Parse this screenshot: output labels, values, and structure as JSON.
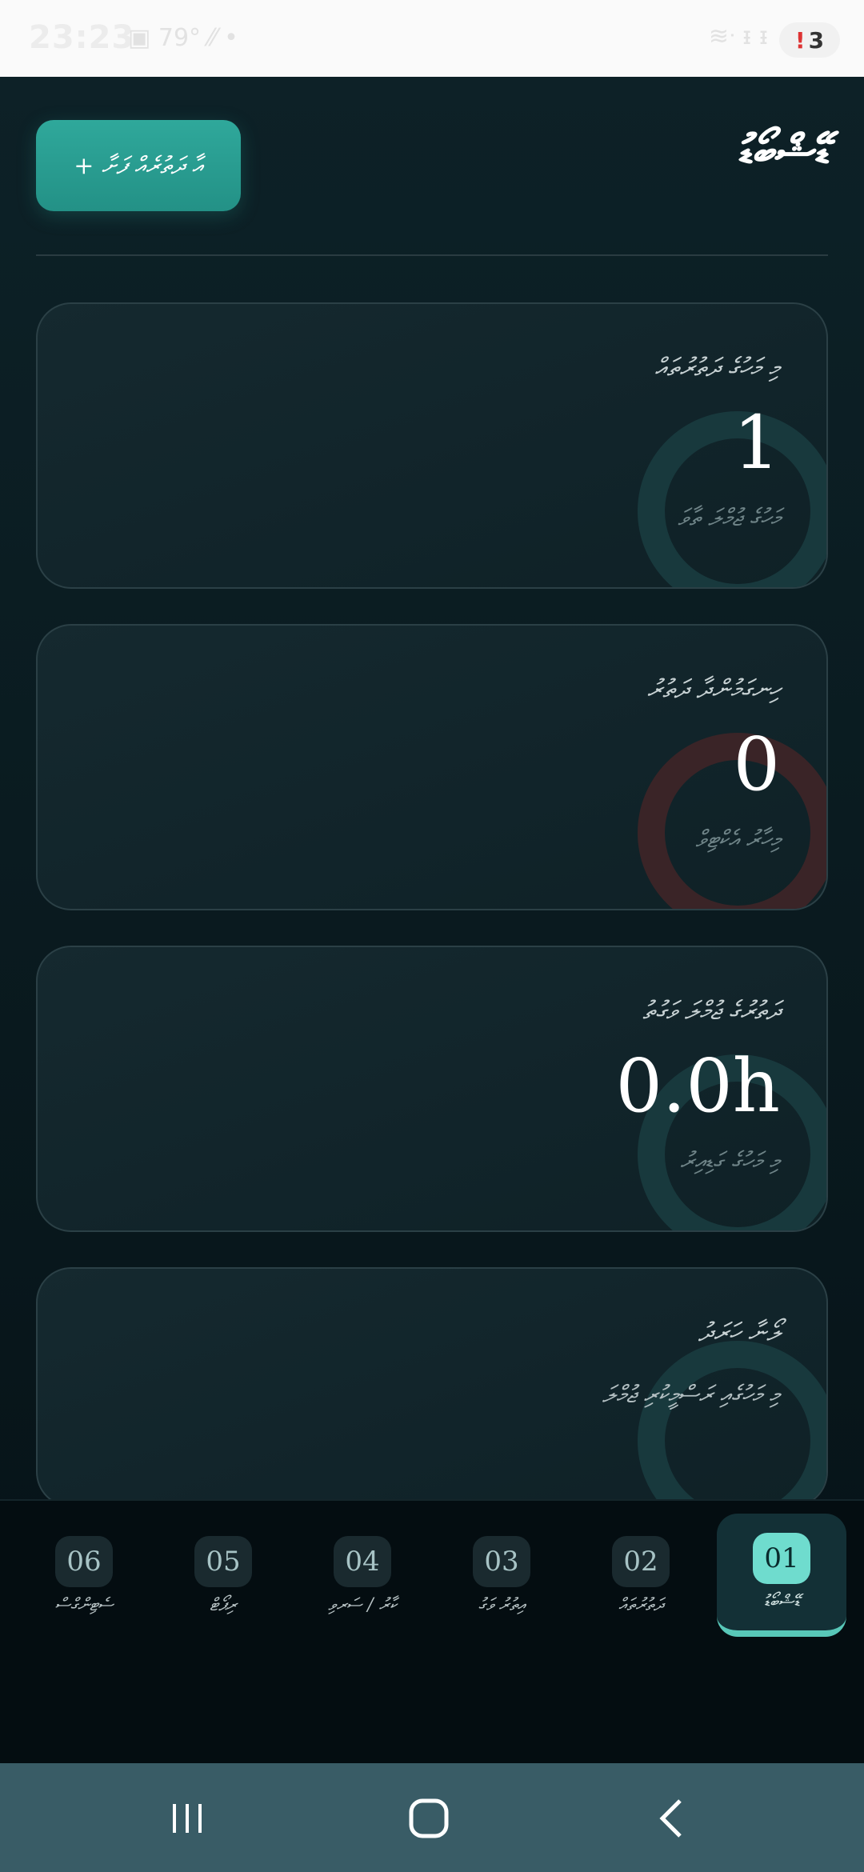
{
  "status_bar": {
    "time": "23:23",
    "left_icons": "▣ 79° ⁄⁄ •",
    "right_icons": "≋ᐧ ᵻ ᵻ",
    "notification_count": "3",
    "notification_mark": "!"
  },
  "header": {
    "title": "ޑޭޝްބޯޑު",
    "add_button_label": "+ އާ ދަތުރެއް ފަށާ"
  },
  "cards": [
    {
      "label": "މި މަހުގެ ދަތުރުތައް",
      "value": "1",
      "sub": "މަހުގެ ޖުމްލަ ތާވަ"
    },
    {
      "label": "ހިނގަމުންދާ ދަތުރު",
      "value": "0",
      "sub": "މިހާރު އެކްޓިވް"
    },
    {
      "label": "ދަތުރުގެ ޖުމްލަ ވަގުތު",
      "value": "0.0h",
      "sub": "މި މަހުގެ ގަޑިއިރު"
    },
    {
      "label": "ލޯނާ ހަރަދު",
      "value": "",
      "sub": "މި މަހުގެއި ރަސްމީކުރި ޖުމްލަ"
    }
  ],
  "tabs": [
    {
      "num": "06",
      "name": "ސެޓިންގްސް"
    },
    {
      "num": "05",
      "name": "ރިޕޯޓް"
    },
    {
      "num": "04",
      "name": "ކާރު / ސަރވި"
    },
    {
      "num": "03",
      "name": "އިތުރު ވަގު"
    },
    {
      "num": "02",
      "name": "ދަތުރުތައް"
    },
    {
      "num": "01",
      "name": "ޑޭޝްބޯޑު"
    }
  ],
  "colors": {
    "accent": "#2fa89b",
    "active_tab": "#6fdcce",
    "background": "#061419",
    "nav_bar": "#395c66"
  }
}
